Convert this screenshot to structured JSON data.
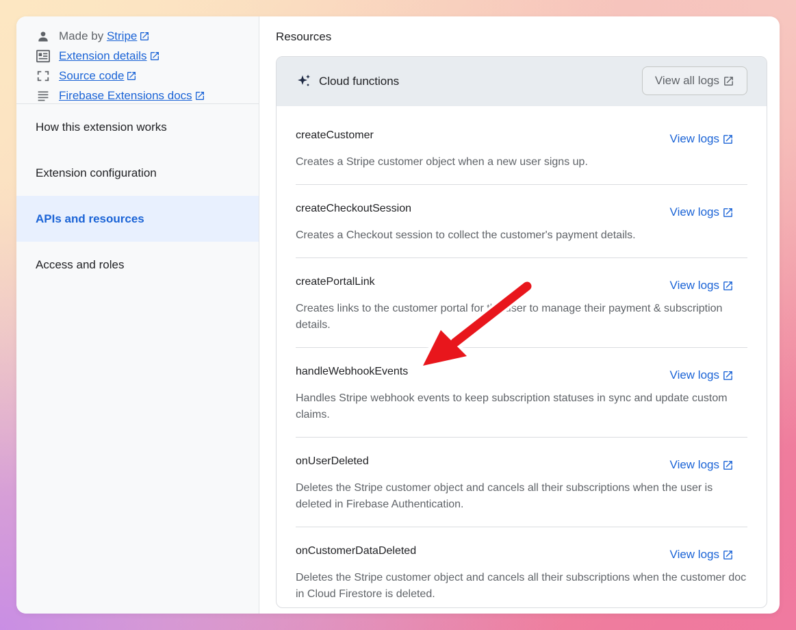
{
  "sidebar": {
    "meta": {
      "made_by_prefix": "Made by",
      "made_by_link": "Stripe",
      "extension_details": "Extension details",
      "source_code": "Source code",
      "docs": "Firebase Extensions docs"
    },
    "nav": [
      {
        "label": "How this extension works"
      },
      {
        "label": "Extension configuration"
      },
      {
        "label": "APIs and resources",
        "active": true
      },
      {
        "label": "Access and roles"
      }
    ]
  },
  "main": {
    "title": "Resources",
    "panel": {
      "title": "Cloud functions",
      "view_all_label": "View all logs",
      "functions": [
        {
          "name": "createCustomer",
          "description": "Creates a Stripe customer object when a new user signs up.",
          "logs_label": "View logs"
        },
        {
          "name": "createCheckoutSession",
          "description": "Creates a Checkout session to collect the customer's payment details.",
          "logs_label": "View logs"
        },
        {
          "name": "createPortalLink",
          "description": "Creates links to the customer portal for the user to manage their payment & subscription details.",
          "logs_label": "View logs"
        },
        {
          "name": "handleWebhookEvents",
          "description": "Handles Stripe webhook events to keep subscription statuses in sync and update custom claims.",
          "logs_label": "View logs"
        },
        {
          "name": "onUserDeleted",
          "description": "Deletes the Stripe customer object and cancels all their subscriptions when the user is deleted in Firebase Authentication.",
          "logs_label": "View logs"
        },
        {
          "name": "onCustomerDataDeleted",
          "description": "Deletes the Stripe customer object and cancels all their subscriptions when the customer doc in Cloud Firestore is deleted.",
          "logs_label": "View logs"
        }
      ]
    }
  },
  "colors": {
    "accent": "#1a63d6",
    "arrow": "#e8141b",
    "active_bg": "#e8f0fe"
  },
  "icons": [
    "person-icon",
    "details-icon",
    "code-icon",
    "docs-icon",
    "external-link-icon",
    "sparkle-icon"
  ]
}
